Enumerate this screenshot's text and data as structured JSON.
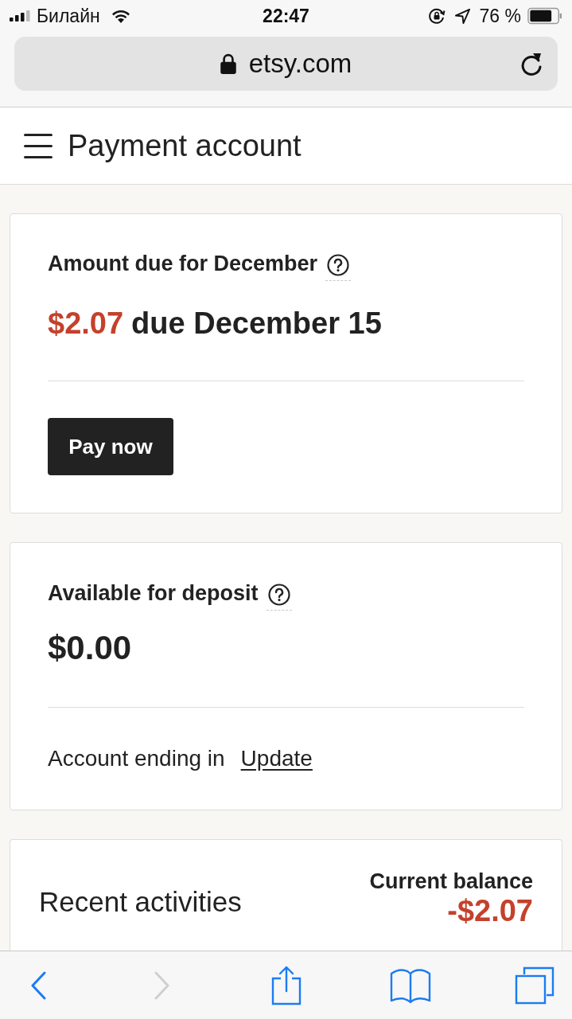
{
  "status_bar": {
    "carrier": "Билайн",
    "time": "22:47",
    "battery": "76 %"
  },
  "address_bar": {
    "url": "etsy.com",
    "secure": true
  },
  "header": {
    "title": "Payment account"
  },
  "amount_due": {
    "title": "Amount due for December",
    "amount": "$2.07",
    "due_text": "due December 15",
    "button": "Pay now"
  },
  "deposit": {
    "title": "Available for deposit",
    "amount": "$0.00",
    "account_text": "Account ending in",
    "link": "Update"
  },
  "activities": {
    "title": "Recent activities",
    "balance_label": "Current balance",
    "balance": "-$2.07"
  },
  "toolbar": [
    {
      "kind": "back",
      "disabled": false
    },
    {
      "kind": "forward",
      "disabled": true
    },
    {
      "kind": "share",
      "disabled": false
    },
    {
      "kind": "bookmarks",
      "disabled": false
    },
    {
      "kind": "tabs",
      "disabled": false
    }
  ]
}
